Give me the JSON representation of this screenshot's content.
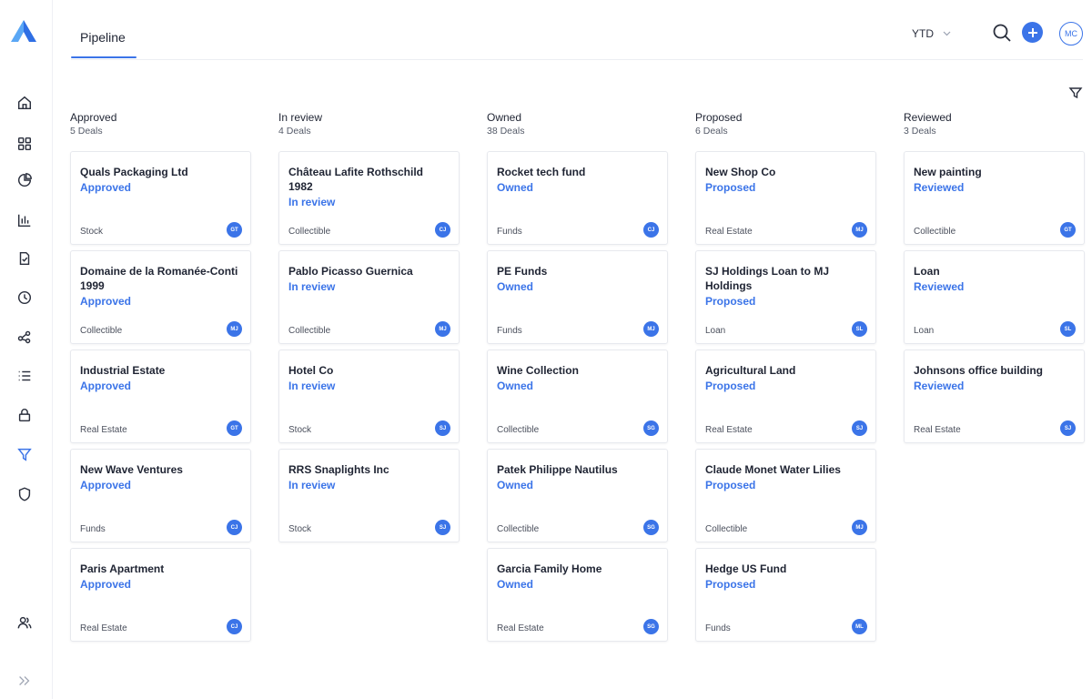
{
  "app": {
    "accent": "#3b74e8"
  },
  "sidebar": {
    "logo": "logo-icon",
    "items": [
      {
        "icon": "home-icon"
      },
      {
        "icon": "dashboard-icon"
      },
      {
        "icon": "pie-chart-icon"
      },
      {
        "icon": "bar-chart-icon"
      },
      {
        "icon": "document-check-icon"
      },
      {
        "icon": "clock-icon"
      },
      {
        "icon": "share-icon"
      },
      {
        "icon": "list-icon"
      },
      {
        "icon": "lock-icon"
      },
      {
        "icon": "filter-icon"
      },
      {
        "icon": "shield-icon"
      }
    ],
    "bottom": [
      {
        "icon": "users-icon"
      },
      {
        "icon": "expand-icon"
      }
    ]
  },
  "header": {
    "tab": "Pipeline",
    "period": "YTD",
    "avatar": "MC"
  },
  "columns": [
    {
      "title": "Approved",
      "count": "5 Deals",
      "cards": [
        {
          "title": "Quals Packaging Ltd",
          "status": "Approved",
          "type": "Stock",
          "avatar": "GT"
        },
        {
          "title": "Domaine de la Romanée-Conti 1999",
          "status": "Approved",
          "type": "Collectible",
          "avatar": "MJ"
        },
        {
          "title": "Industrial Estate",
          "status": "Approved",
          "type": "Real Estate",
          "avatar": "GT"
        },
        {
          "title": "New Wave Ventures",
          "status": "Approved",
          "type": "Funds",
          "avatar": "CJ"
        },
        {
          "title": "Paris Apartment",
          "status": "Approved",
          "type": "Real Estate",
          "avatar": "CJ"
        }
      ]
    },
    {
      "title": "In review",
      "count": "4 Deals",
      "cards": [
        {
          "title": "Château Lafite Rothschild 1982",
          "status": "In review",
          "type": "Collectible",
          "avatar": "CJ"
        },
        {
          "title": "Pablo Picasso Guernica",
          "status": "In review",
          "type": "Collectible",
          "avatar": "MJ"
        },
        {
          "title": "Hotel Co",
          "status": "In review",
          "type": "Stock",
          "avatar": "SJ"
        },
        {
          "title": "RRS Snaplights Inc",
          "status": "In review",
          "type": "Stock",
          "avatar": "SJ"
        }
      ]
    },
    {
      "title": "Owned",
      "count": "38 Deals",
      "cards": [
        {
          "title": "Rocket tech fund",
          "status": "Owned",
          "type": "Funds",
          "avatar": "CJ"
        },
        {
          "title": "PE Funds",
          "status": "Owned",
          "type": "Funds",
          "avatar": "MJ"
        },
        {
          "title": "Wine Collection",
          "status": "Owned",
          "type": "Collectible",
          "avatar": "SG"
        },
        {
          "title": "Patek Philippe Nautilus",
          "status": "Owned",
          "type": "Collectible",
          "avatar": "SG"
        },
        {
          "title": "Garcia Family Home",
          "status": "Owned",
          "type": "Real Estate",
          "avatar": "SG"
        }
      ]
    },
    {
      "title": "Proposed",
      "count": "6 Deals",
      "cards": [
        {
          "title": "New Shop Co",
          "status": "Proposed",
          "type": "Real Estate",
          "avatar": "MJ"
        },
        {
          "title": "SJ Holdings Loan to MJ Holdings",
          "status": "Proposed",
          "type": "Loan",
          "avatar": "SL"
        },
        {
          "title": "Agricultural Land",
          "status": "Proposed",
          "type": "Real Estate",
          "avatar": "SJ"
        },
        {
          "title": "Claude Monet Water Lilies",
          "status": "Proposed",
          "type": "Collectible",
          "avatar": "MJ"
        },
        {
          "title": "Hedge US Fund",
          "status": "Proposed",
          "type": "Funds",
          "avatar": "ML"
        }
      ]
    },
    {
      "title": "Reviewed",
      "count": "3 Deals",
      "cards": [
        {
          "title": "New painting",
          "status": "Reviewed",
          "type": "Collectible",
          "avatar": "GT"
        },
        {
          "title": "Loan",
          "status": "Reviewed",
          "type": "Loan",
          "avatar": "SL"
        },
        {
          "title": "Johnsons office building",
          "status": "Reviewed",
          "type": "Real Estate",
          "avatar": "SJ"
        }
      ]
    }
  ]
}
